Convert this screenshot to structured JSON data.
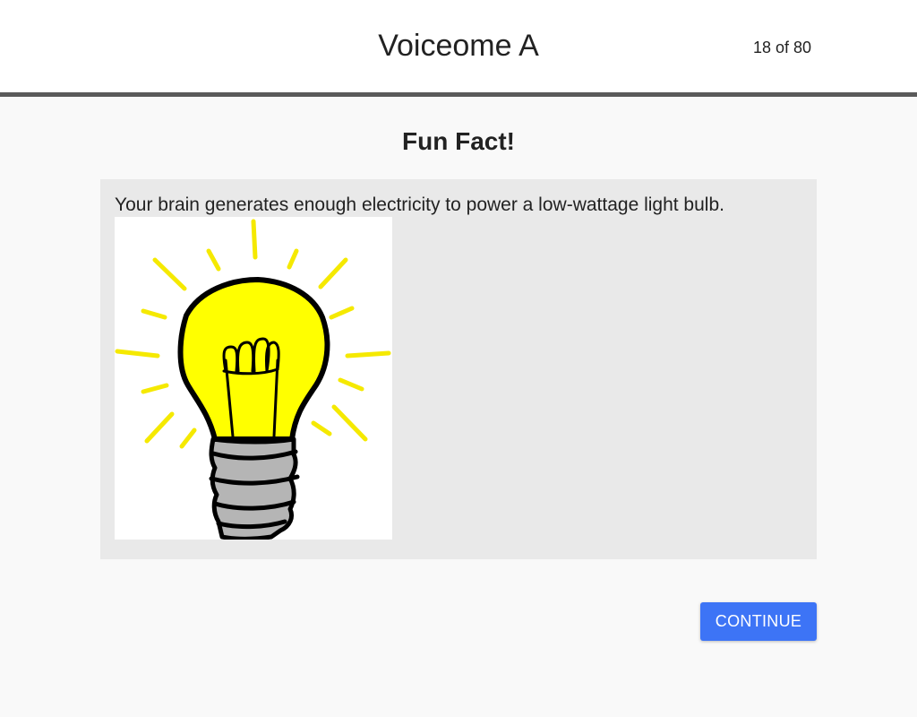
{
  "header": {
    "title": "Voiceome A",
    "progress": "18 of 80"
  },
  "main": {
    "heading": "Fun Fact!",
    "fact_text": "Your brain generates enough electricity to power a low-wattage light bulb.",
    "image_icon": "light-bulb-illustration"
  },
  "actions": {
    "continue_label": "CONTINUE"
  },
  "colors": {
    "accent": "#3d74f6",
    "header_divider": "#5a5a5a",
    "card_background": "#e9e9e9",
    "bulb_yellow": "#ffff00"
  }
}
